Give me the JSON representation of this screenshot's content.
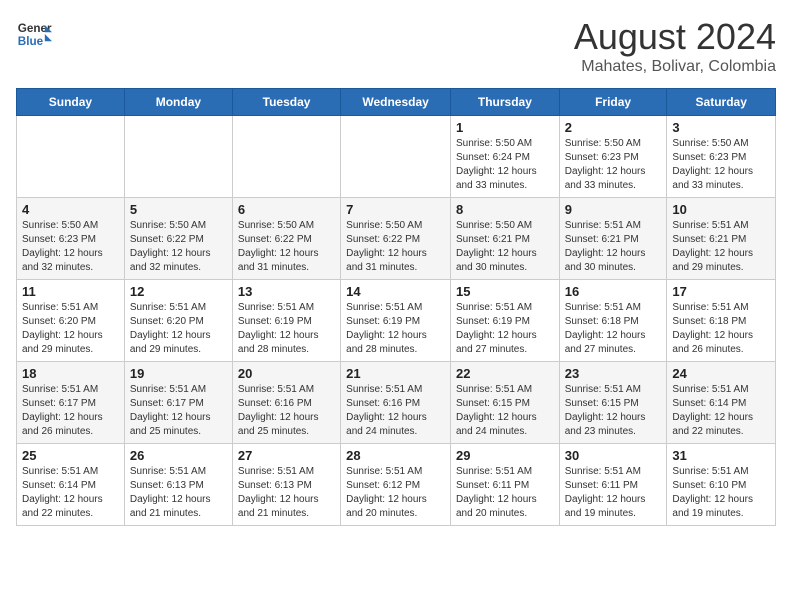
{
  "header": {
    "logo_line1": "General",
    "logo_line2": "Blue",
    "month": "August 2024",
    "location": "Mahates, Bolivar, Colombia"
  },
  "days_of_week": [
    "Sunday",
    "Monday",
    "Tuesday",
    "Wednesday",
    "Thursday",
    "Friday",
    "Saturday"
  ],
  "weeks": [
    [
      {
        "day": "",
        "info": ""
      },
      {
        "day": "",
        "info": ""
      },
      {
        "day": "",
        "info": ""
      },
      {
        "day": "",
        "info": ""
      },
      {
        "day": "1",
        "info": "Sunrise: 5:50 AM\nSunset: 6:24 PM\nDaylight: 12 hours\nand 33 minutes."
      },
      {
        "day": "2",
        "info": "Sunrise: 5:50 AM\nSunset: 6:23 PM\nDaylight: 12 hours\nand 33 minutes."
      },
      {
        "day": "3",
        "info": "Sunrise: 5:50 AM\nSunset: 6:23 PM\nDaylight: 12 hours\nand 33 minutes."
      }
    ],
    [
      {
        "day": "4",
        "info": "Sunrise: 5:50 AM\nSunset: 6:23 PM\nDaylight: 12 hours\nand 32 minutes."
      },
      {
        "day": "5",
        "info": "Sunrise: 5:50 AM\nSunset: 6:22 PM\nDaylight: 12 hours\nand 32 minutes."
      },
      {
        "day": "6",
        "info": "Sunrise: 5:50 AM\nSunset: 6:22 PM\nDaylight: 12 hours\nand 31 minutes."
      },
      {
        "day": "7",
        "info": "Sunrise: 5:50 AM\nSunset: 6:22 PM\nDaylight: 12 hours\nand 31 minutes."
      },
      {
        "day": "8",
        "info": "Sunrise: 5:50 AM\nSunset: 6:21 PM\nDaylight: 12 hours\nand 30 minutes."
      },
      {
        "day": "9",
        "info": "Sunrise: 5:51 AM\nSunset: 6:21 PM\nDaylight: 12 hours\nand 30 minutes."
      },
      {
        "day": "10",
        "info": "Sunrise: 5:51 AM\nSunset: 6:21 PM\nDaylight: 12 hours\nand 29 minutes."
      }
    ],
    [
      {
        "day": "11",
        "info": "Sunrise: 5:51 AM\nSunset: 6:20 PM\nDaylight: 12 hours\nand 29 minutes."
      },
      {
        "day": "12",
        "info": "Sunrise: 5:51 AM\nSunset: 6:20 PM\nDaylight: 12 hours\nand 29 minutes."
      },
      {
        "day": "13",
        "info": "Sunrise: 5:51 AM\nSunset: 6:19 PM\nDaylight: 12 hours\nand 28 minutes."
      },
      {
        "day": "14",
        "info": "Sunrise: 5:51 AM\nSunset: 6:19 PM\nDaylight: 12 hours\nand 28 minutes."
      },
      {
        "day": "15",
        "info": "Sunrise: 5:51 AM\nSunset: 6:19 PM\nDaylight: 12 hours\nand 27 minutes."
      },
      {
        "day": "16",
        "info": "Sunrise: 5:51 AM\nSunset: 6:18 PM\nDaylight: 12 hours\nand 27 minutes."
      },
      {
        "day": "17",
        "info": "Sunrise: 5:51 AM\nSunset: 6:18 PM\nDaylight: 12 hours\nand 26 minutes."
      }
    ],
    [
      {
        "day": "18",
        "info": "Sunrise: 5:51 AM\nSunset: 6:17 PM\nDaylight: 12 hours\nand 26 minutes."
      },
      {
        "day": "19",
        "info": "Sunrise: 5:51 AM\nSunset: 6:17 PM\nDaylight: 12 hours\nand 25 minutes."
      },
      {
        "day": "20",
        "info": "Sunrise: 5:51 AM\nSunset: 6:16 PM\nDaylight: 12 hours\nand 25 minutes."
      },
      {
        "day": "21",
        "info": "Sunrise: 5:51 AM\nSunset: 6:16 PM\nDaylight: 12 hours\nand 24 minutes."
      },
      {
        "day": "22",
        "info": "Sunrise: 5:51 AM\nSunset: 6:15 PM\nDaylight: 12 hours\nand 24 minutes."
      },
      {
        "day": "23",
        "info": "Sunrise: 5:51 AM\nSunset: 6:15 PM\nDaylight: 12 hours\nand 23 minutes."
      },
      {
        "day": "24",
        "info": "Sunrise: 5:51 AM\nSunset: 6:14 PM\nDaylight: 12 hours\nand 22 minutes."
      }
    ],
    [
      {
        "day": "25",
        "info": "Sunrise: 5:51 AM\nSunset: 6:14 PM\nDaylight: 12 hours\nand 22 minutes."
      },
      {
        "day": "26",
        "info": "Sunrise: 5:51 AM\nSunset: 6:13 PM\nDaylight: 12 hours\nand 21 minutes."
      },
      {
        "day": "27",
        "info": "Sunrise: 5:51 AM\nSunset: 6:13 PM\nDaylight: 12 hours\nand 21 minutes."
      },
      {
        "day": "28",
        "info": "Sunrise: 5:51 AM\nSunset: 6:12 PM\nDaylight: 12 hours\nand 20 minutes."
      },
      {
        "day": "29",
        "info": "Sunrise: 5:51 AM\nSunset: 6:11 PM\nDaylight: 12 hours\nand 20 minutes."
      },
      {
        "day": "30",
        "info": "Sunrise: 5:51 AM\nSunset: 6:11 PM\nDaylight: 12 hours\nand 19 minutes."
      },
      {
        "day": "31",
        "info": "Sunrise: 5:51 AM\nSunset: 6:10 PM\nDaylight: 12 hours\nand 19 minutes."
      }
    ]
  ]
}
